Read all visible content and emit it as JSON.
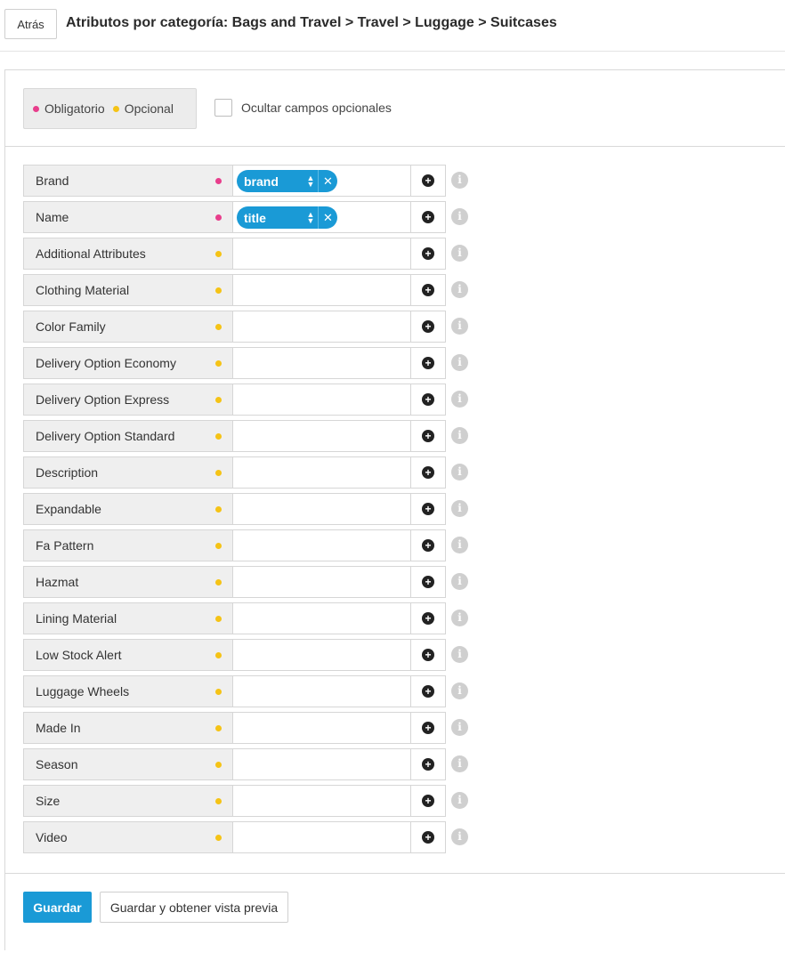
{
  "header": {
    "back_label": "Atrás",
    "title": "Atributos por categoría: Bags and Travel > Travel > Luggage > Suitcases"
  },
  "legend": {
    "required_label": "Obligatorio",
    "optional_label": "Opcional",
    "hide_optional_label": "Ocultar campos opcionales",
    "required_color": "#e83e8c",
    "optional_color": "#f5c316"
  },
  "rows": [
    {
      "label": "Brand",
      "required": true,
      "tag": "brand"
    },
    {
      "label": "Name",
      "required": true,
      "tag": "title"
    },
    {
      "label": "Additional Attributes",
      "required": false
    },
    {
      "label": "Clothing Material",
      "required": false
    },
    {
      "label": "Color Family",
      "required": false
    },
    {
      "label": "Delivery Option Economy",
      "required": false
    },
    {
      "label": "Delivery Option Express",
      "required": false
    },
    {
      "label": "Delivery Option Standard",
      "required": false
    },
    {
      "label": "Description",
      "required": false
    },
    {
      "label": "Expandable",
      "required": false
    },
    {
      "label": "Fa Pattern",
      "required": false
    },
    {
      "label": "Hazmat",
      "required": false
    },
    {
      "label": "Lining Material",
      "required": false
    },
    {
      "label": "Low Stock Alert",
      "required": false
    },
    {
      "label": "Luggage Wheels",
      "required": false
    },
    {
      "label": "Made In",
      "required": false
    },
    {
      "label": "Season",
      "required": false
    },
    {
      "label": "Size",
      "required": false
    },
    {
      "label": "Video",
      "required": false
    }
  ],
  "footer": {
    "save_label": "Guardar",
    "preview_label": "Guardar y obtener vista previa"
  },
  "icons": {
    "add": "plus-circle-icon",
    "info": "info-circle-icon",
    "sort": "sort-icon",
    "remove": "close-icon"
  }
}
